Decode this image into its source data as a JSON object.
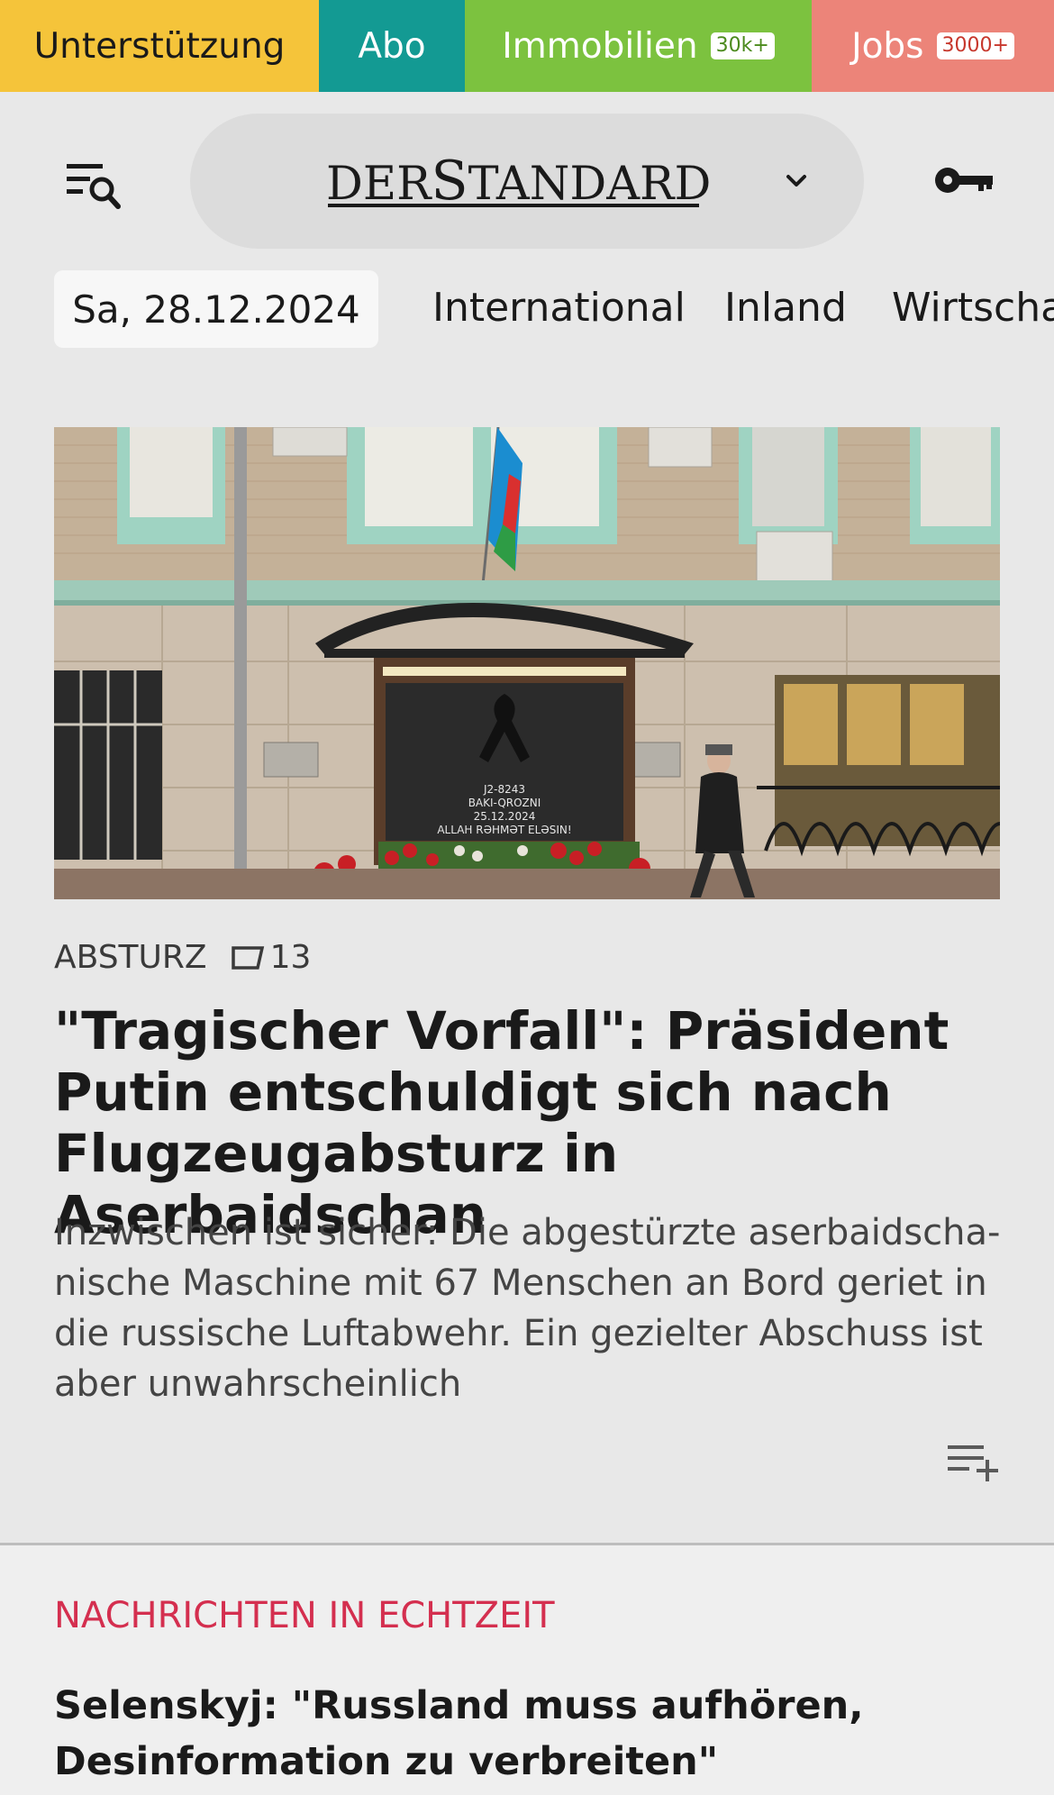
{
  "topbar": {
    "support_label": "Unterstützung",
    "abo_label": "Abo",
    "immobilien_label": "Immobilien",
    "immobilien_badge": "30k+",
    "jobs_label": "Jobs",
    "jobs_badge": "3000+",
    "colors": {
      "support": "#f5c43a",
      "abo": "#139a93",
      "immobilien": "#7cc23f",
      "jobs": "#ec8479"
    }
  },
  "header": {
    "logo_text_1": "DER",
    "logo_text_2": "S",
    "logo_text_3": "TANDARD",
    "icons": {
      "menu": "menu-search-icon",
      "edition_toggle": "chevron-down-icon",
      "login": "key-icon"
    }
  },
  "nav": {
    "date": "Sa, 28.12.2024",
    "items": [
      "International",
      "Inland",
      "Wirtscha"
    ]
  },
  "article": {
    "image_label": "Azerbaijani embassy memorial with flowers",
    "banner_lines": [
      "J2-8243",
      "BAKI-QROZNI",
      "25.12.2024",
      "ALLAH RƏHMƏT ELƏSIN!"
    ],
    "kicker": "ABSTURZ",
    "comment_count": "13",
    "headline": "\"Tragischer Vorfall\": Präsident Putin entschuldigt sich nach Flugzeugab­sturz in Aserbaidschan",
    "teaser": "Inzwischen ist sicher: Die abgestürzte aserbaidscha­nische Maschine mit 67 Menschen an Bord geriet in die russische Luftabwehr. Ein gezielter Abschuss ist aber unwahrscheinlich",
    "add_icon": "playlist-add-icon"
  },
  "live": {
    "section_title": "NACHRICHTEN IN ECHTZEIT",
    "headline": "Selenskyj: \"Russland muss aufhören, Desinfor­mation zu verbreiten\"",
    "accent_color": "#d42f4f"
  }
}
